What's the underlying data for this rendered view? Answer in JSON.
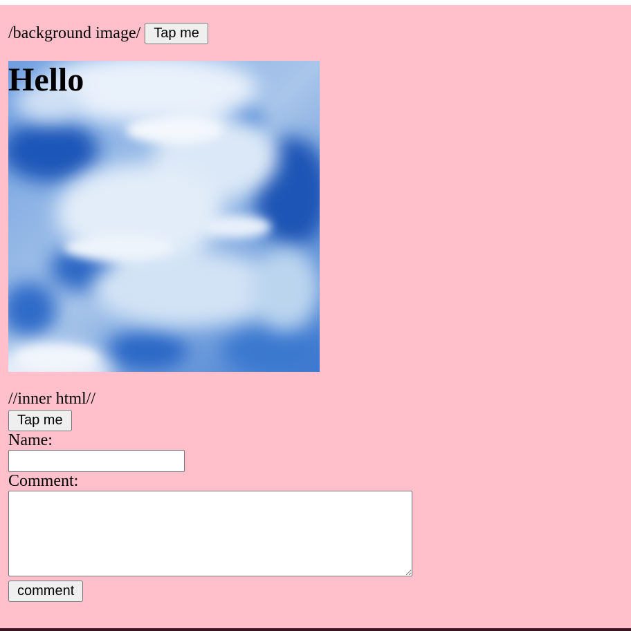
{
  "background_section": {
    "label": "/background image/",
    "button_label": "Tap me",
    "image_heading": "Hello"
  },
  "inner_section": {
    "label": "//inner html//",
    "button_label": "Tap me"
  },
  "form": {
    "name_label": "Name:",
    "name_value": "",
    "comment_label": "Comment:",
    "comment_value": "",
    "submit_label": "comment"
  },
  "colors": {
    "page_background": "#ffc0cb",
    "button_background": "#efefef",
    "sky_blue": "#1f5fbf"
  }
}
